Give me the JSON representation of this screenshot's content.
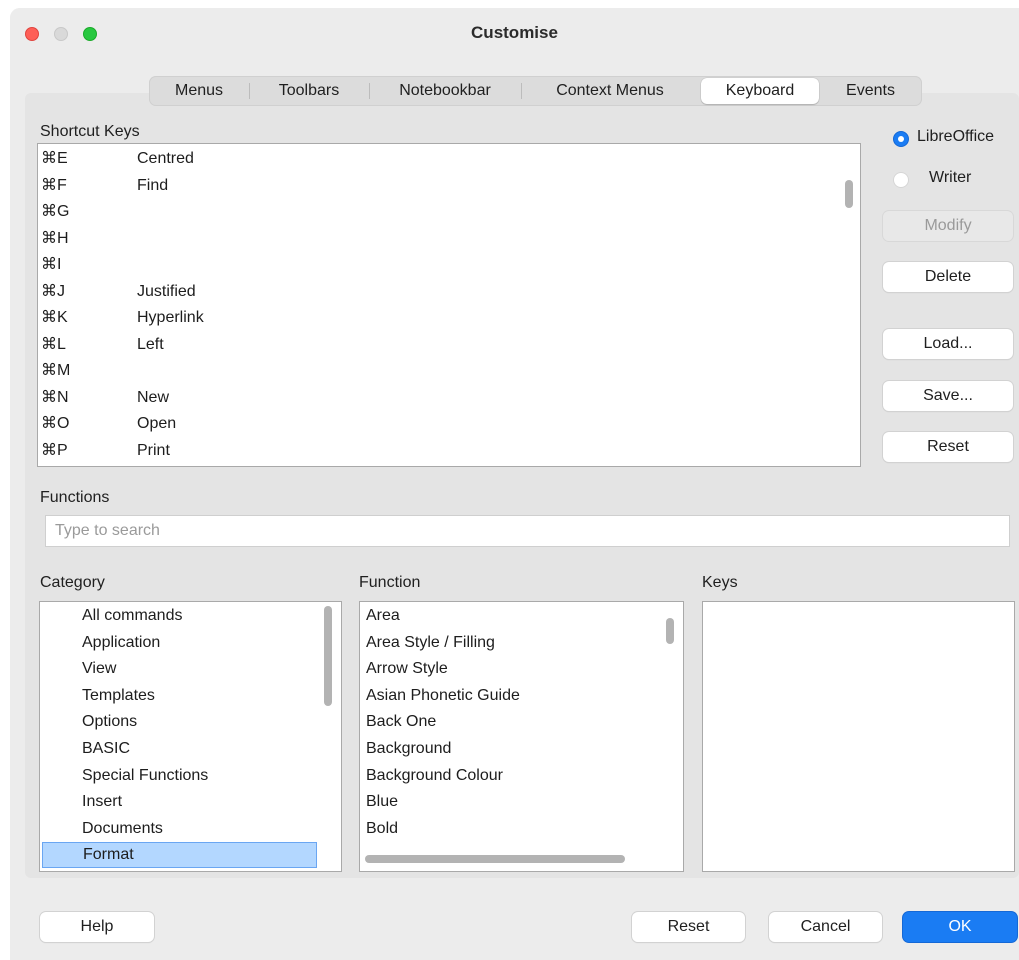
{
  "window": {
    "title": "Customise"
  },
  "colors": {
    "accent": "#1a7cf3",
    "selection": "#b3d7ff",
    "close": "#fe5f57",
    "zoom": "#28c840"
  },
  "tabs": [
    "Menus",
    "Toolbars",
    "Notebookbar",
    "Context Menus",
    "Keyboard",
    "Events"
  ],
  "active_tab": "Keyboard",
  "shortcut_keys": {
    "label": "Shortcut Keys",
    "rows": [
      {
        "key": "⌘E",
        "function": "Centred"
      },
      {
        "key": "⌘F",
        "function": "Find"
      },
      {
        "key": "⌘G",
        "function": ""
      },
      {
        "key": "⌘H",
        "function": ""
      },
      {
        "key": "⌘I",
        "function": ""
      },
      {
        "key": "⌘J",
        "function": "Justified"
      },
      {
        "key": "⌘K",
        "function": "Hyperlink"
      },
      {
        "key": "⌘L",
        "function": "Left"
      },
      {
        "key": "⌘M",
        "function": ""
      },
      {
        "key": "⌘N",
        "function": "New"
      },
      {
        "key": "⌘O",
        "function": "Open"
      },
      {
        "key": "⌘P",
        "function": "Print"
      }
    ]
  },
  "scope": {
    "options": [
      "LibreOffice",
      "Writer"
    ],
    "selected": "LibreOffice"
  },
  "side_buttons": {
    "modify": "Modify",
    "delete": "Delete",
    "load": "Load...",
    "save": "Save...",
    "reset": "Reset"
  },
  "functions": {
    "label": "Functions",
    "search_placeholder": "Type to search",
    "search_value": ""
  },
  "category": {
    "label": "Category",
    "items": [
      "All commands",
      "Application",
      "View",
      "Templates",
      "Options",
      "BASIC",
      "Special Functions",
      "Insert",
      "Documents",
      "Format"
    ],
    "selected": "Format"
  },
  "function_list": {
    "label": "Function",
    "items": [
      "Area",
      "Area Style / Filling",
      "Arrow Style",
      "Asian Phonetic Guide",
      "Back One",
      "Background",
      "Background Colour",
      "Blue",
      "Bold"
    ]
  },
  "keys": {
    "label": "Keys",
    "items": []
  },
  "footer": {
    "help": "Help",
    "reset": "Reset",
    "cancel": "Cancel",
    "ok": "OK"
  }
}
